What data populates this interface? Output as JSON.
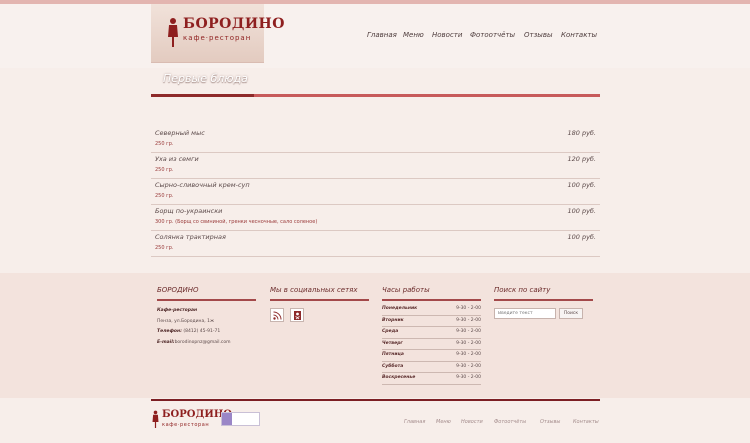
{
  "header": {
    "logo_title": "БОРОДИНО",
    "logo_subtitle": "кафе·ресторан",
    "nav": [
      "Главная",
      "Меню",
      "Новости",
      "Фотоотчёты",
      "Отзывы",
      "Контакты"
    ]
  },
  "page": {
    "title": "Первые блюда"
  },
  "menu_items": [
    {
      "name": "Северный мыс",
      "price": "180 руб.",
      "weight": "250 гр."
    },
    {
      "name": "Уха из семги",
      "price": "120 руб.",
      "weight": "250 гр."
    },
    {
      "name": "Сырно-сливочный крем-суп",
      "price": "100 руб.",
      "weight": "250 гр."
    },
    {
      "name": "Борщ по-украински",
      "price": "100 руб.",
      "weight": "300 гр. (Борщ со свининой, гренки чесночные, сало соленое)"
    },
    {
      "name": "Солянка трактирная",
      "price": "100 руб.",
      "weight": "250 гр."
    }
  ],
  "footer": {
    "about": {
      "title": "БОРОДИНО",
      "type": "Кафе-ресторан",
      "address": "Пенза, ул.Бородина, 1ж",
      "phone_label": "Телефон:",
      "phone": "(8412) 45-91-71",
      "email_label": "E-mail:",
      "email": "borodinopnz@gmail.com"
    },
    "social": {
      "title": "Мы в социальных сетях",
      "icons": [
        "rss-icon",
        "odnoklassniki-icon"
      ]
    },
    "hours": {
      "title": "Часы работы",
      "days": [
        {
          "day": "Понедельник",
          "time": "9-30 - 2-00"
        },
        {
          "day": "Вторник",
          "time": "9-30 - 2-00"
        },
        {
          "day": "Среда",
          "time": "9-30 - 2-00"
        },
        {
          "day": "Четверг",
          "time": "9-30 - 2-00"
        },
        {
          "day": "Пятница",
          "time": "9-30 - 2-00"
        },
        {
          "day": "Суббота",
          "time": "9-30 - 2-00"
        },
        {
          "day": "Воскресенье",
          "time": "9-30 - 2-00"
        }
      ]
    },
    "search": {
      "title": "Поиск по сайту",
      "placeholder": "Введите текст",
      "button": "Поиск"
    }
  },
  "bottom": {
    "logo_title": "БОРОДИНО",
    "logo_subtitle": "кафе·ресторан",
    "nav": [
      "Главная",
      "Меню",
      "Новости",
      "Фотоотчёты",
      "Отзывы",
      "Контакты"
    ]
  },
  "colors": {
    "accent": "#c75a5b",
    "dark_accent": "#7c1f24",
    "brand": "#8e1f1f"
  }
}
